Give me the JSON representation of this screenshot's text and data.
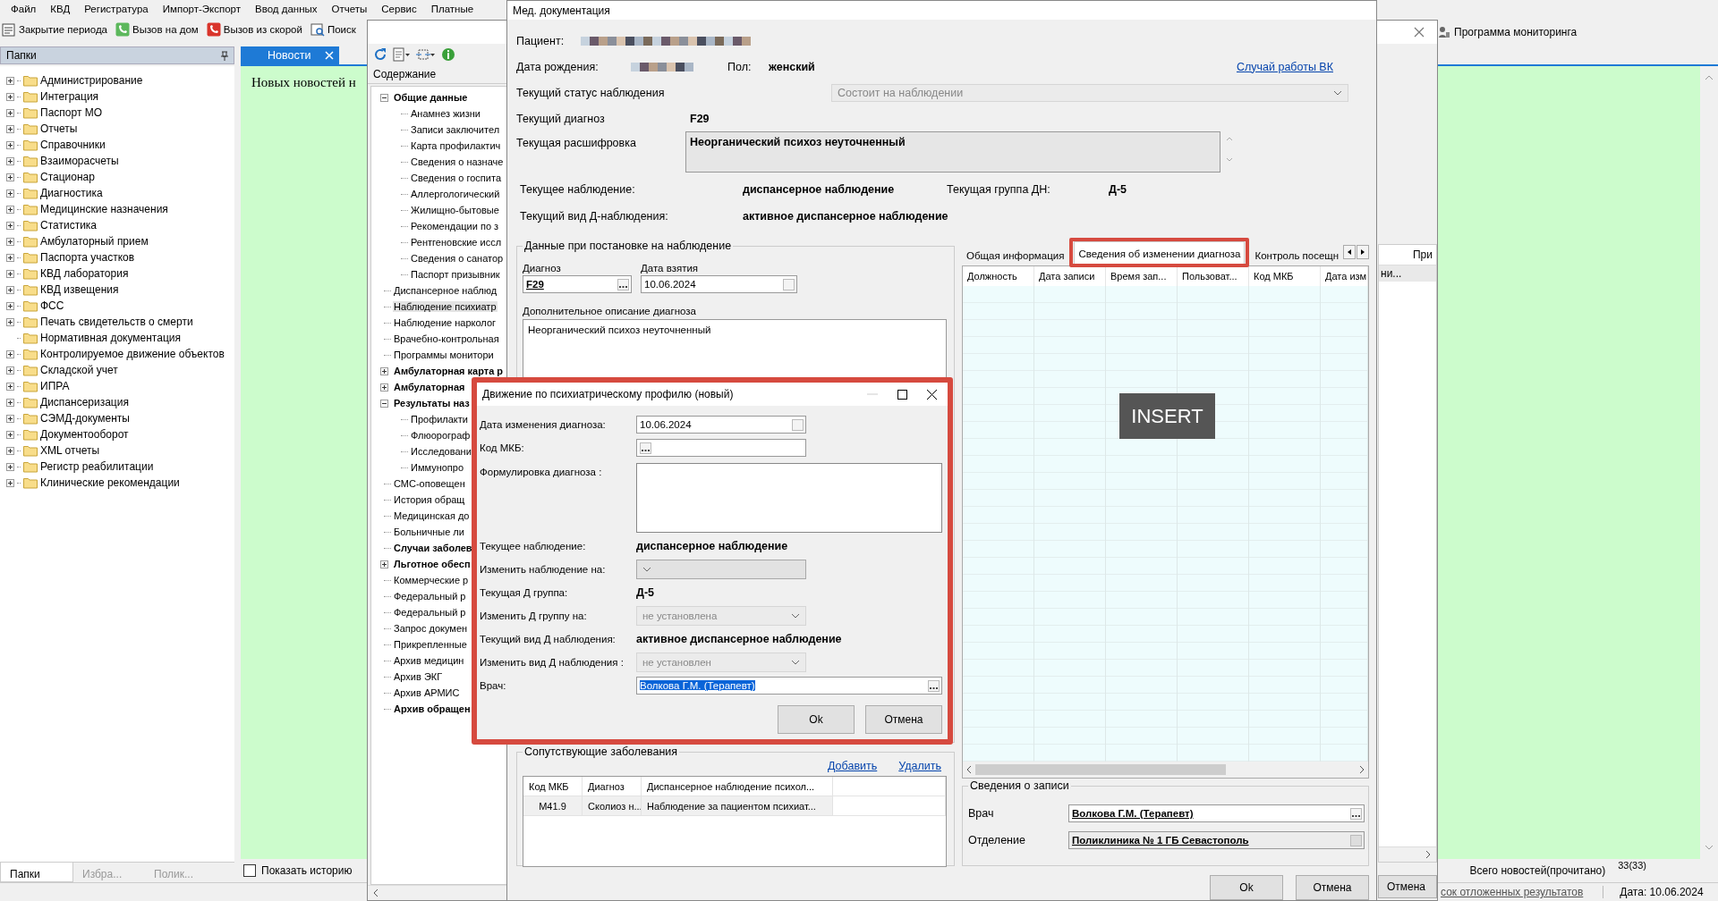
{
  "menu": [
    "Файл",
    "КВД",
    "Регистратура",
    "Импорт-Экспорт",
    "Ввод данных",
    "Отчеты",
    "Сервис",
    "Платные"
  ],
  "toolbar": [
    "Закрытие периода",
    "Вызов на дом",
    "Вызов из скорой",
    "Поиск"
  ],
  "toolbar_right": "Программа мониторинга",
  "folders": {
    "title": "Папки",
    "items": [
      {
        "label": "Администрирование",
        "expandable": true
      },
      {
        "label": "Интеграция",
        "expandable": true
      },
      {
        "label": "Паспорт МО",
        "expandable": true
      },
      {
        "label": "Отчеты",
        "expandable": true
      },
      {
        "label": "Справочники",
        "expandable": true
      },
      {
        "label": "Взаиморасчеты",
        "expandable": true
      },
      {
        "label": "Стационар",
        "expandable": true
      },
      {
        "label": "Диагностика",
        "expandable": true
      },
      {
        "label": "Медицинские назначения",
        "expandable": true
      },
      {
        "label": "Статистика",
        "expandable": true
      },
      {
        "label": "Амбулаторный прием",
        "expandable": true
      },
      {
        "label": "Паспорта участков",
        "expandable": true
      },
      {
        "label": "КВД лаборатория",
        "expandable": true
      },
      {
        "label": "КВД извещения",
        "expandable": true
      },
      {
        "label": "ФСС",
        "expandable": true
      },
      {
        "label": "Печать свидетельств о смерти",
        "expandable": true
      },
      {
        "label": "Нормативная документация",
        "expandable": false
      },
      {
        "label": "Контролируемое движение объектов",
        "expandable": true
      },
      {
        "label": "Складской учет",
        "expandable": true
      },
      {
        "label": "ИПРА",
        "expandable": true
      },
      {
        "label": "Диспансеризация",
        "expandable": true
      },
      {
        "label": "СЭМД-документы",
        "expandable": true
      },
      {
        "label": "Документооборот",
        "expandable": true
      },
      {
        "label": "XML отчеты",
        "expandable": true
      },
      {
        "label": "Регистр реабилитации",
        "expandable": true
      },
      {
        "label": "Клинические рекомендации",
        "expandable": true
      }
    ],
    "tabs": [
      {
        "label": "Папки",
        "selected": true
      },
      {
        "label": "Избра...",
        "selected": false
      },
      {
        "label": "Полик...",
        "selected": false
      }
    ]
  },
  "news": {
    "tab": "Новости",
    "message": "Новых новостей н",
    "show_history": {
      "label": "Показать историю",
      "checked": false
    },
    "total_label": "Всего новостей(прочитано)",
    "total": "33(33)"
  },
  "status_bar": {
    "link": "сок отложенных результатов",
    "date": "Дата: 10.06.2024"
  },
  "contents": {
    "header": "Содержание",
    "tree": [
      {
        "label": "Общие данные",
        "bold": true,
        "selected": false,
        "expanded": true,
        "children": [
          {
            "label": "Анамнез жизни",
            "bold": false,
            "selected": false
          },
          {
            "label": "Записи заключител",
            "bold": false,
            "selected": false
          },
          {
            "label": "Карта профилактич",
            "bold": false,
            "selected": false
          },
          {
            "label": "Сведения о назначе",
            "bold": false,
            "selected": false
          },
          {
            "label": "Сведения о госпита",
            "bold": false,
            "selected": false
          },
          {
            "label": "Аллергологический",
            "bold": false,
            "selected": false
          },
          {
            "label": "Жилищно-бытовые",
            "bold": false,
            "selected": false
          },
          {
            "label": "Рекомендации по з",
            "bold": false,
            "selected": false
          },
          {
            "label": "Рентгеновские иссл",
            "bold": false,
            "selected": false
          },
          {
            "label": "Сведения о санатор",
            "bold": false,
            "selected": false
          },
          {
            "label": "Паспорт призывник",
            "bold": false,
            "selected": false
          }
        ]
      },
      {
        "label": "Диспансерное наблюд",
        "bold": false,
        "selected": false
      },
      {
        "label": "Наблюдение психиатр",
        "bold": false,
        "selected": true
      },
      {
        "label": "Наблюдение нарколог",
        "bold": false,
        "selected": false
      },
      {
        "label": "Врачебно-контрольная",
        "bold": false,
        "selected": false
      },
      {
        "label": "Программы монитори",
        "bold": false,
        "selected": false
      },
      {
        "label": "Амбулаторная карта р",
        "bold": true,
        "selected": false,
        "expanded": false
      },
      {
        "label": "Амбулаторная",
        "bold": true,
        "selected": false,
        "expanded": false
      },
      {
        "label": "Результаты наз",
        "bold": true,
        "selected": false,
        "expanded": true,
        "children": [
          {
            "label": "Профилакти",
            "bold": false,
            "selected": false
          },
          {
            "label": "Флюорограф",
            "bold": false,
            "selected": false
          },
          {
            "label": "Исследовани",
            "bold": false,
            "selected": false
          },
          {
            "label": "Иммунопро",
            "bold": false,
            "selected": false
          }
        ]
      },
      {
        "label": "СМС-оповещен",
        "bold": false,
        "selected": false
      },
      {
        "label": "История обращ",
        "bold": false,
        "selected": false
      },
      {
        "label": "Медицинская до",
        "bold": false,
        "selected": false
      },
      {
        "label": "Больничные ли",
        "bold": false,
        "selected": false
      },
      {
        "label": "Случаи заболев",
        "bold": true,
        "selected": false
      },
      {
        "label": "Льготное обесп",
        "bold": true,
        "selected": false,
        "expanded": false
      },
      {
        "label": "Коммерческие р",
        "bold": false,
        "selected": false
      },
      {
        "label": "Федеральный р",
        "bold": false,
        "selected": false
      },
      {
        "label": "Федеральный р",
        "bold": false,
        "selected": false
      },
      {
        "label": "Запрос докумен",
        "bold": false,
        "selected": false
      },
      {
        "label": "Прикрепленные",
        "bold": false,
        "selected": false
      },
      {
        "label": "Архив медицин",
        "bold": false,
        "selected": false
      },
      {
        "label": "Архив ЭКГ",
        "bold": false,
        "selected": false
      },
      {
        "label": "Архив АРМИС",
        "bold": false,
        "selected": false
      },
      {
        "label": "Архив обращен",
        "bold": true,
        "selected": false
      }
    ],
    "column": "При",
    "cell": "ни...",
    "cancel": "Отмена"
  },
  "med_doc": {
    "title": "Мед. документация",
    "patient_label": "Пациент:",
    "birth_label": "Дата рождения:",
    "sex_label": "Пол:",
    "sex": "женский",
    "vk_link": "Случай работы ВК",
    "status_label": "Текущий статус наблюдения",
    "status": {
      "value": "Состоит на наблюдении",
      "disabled": true
    },
    "diagnosis_label": "Текущий диагноз",
    "diagnosis": "F29",
    "decoding_label": "Текущая расшифровка",
    "decoding": "Неорганический психоз неуточненный",
    "observation_label": "Текущее наблюдение:",
    "observation": "диспансерное наблюдение",
    "group_label": "Текущая группа ДН:",
    "group": "Д-5",
    "type_label": "Текущий вид Д-наблюдения:",
    "type": "активное диспансерное наблюдение",
    "registration": {
      "title": "Данные при постановке на наблюдение",
      "diagnosis_label": "Диагноз",
      "diagnosis": "F29",
      "date_label": "Дата взятия",
      "date": "10.06.2024",
      "description_label": "Дополнительное описание диагноза",
      "description": "Неорганический психоз неуточненный"
    },
    "tabs": [
      {
        "label": "Общая информация",
        "selected": false
      },
      {
        "label": "Сведения об изменении диагноза",
        "selected": true
      },
      {
        "label": "Контроль посещн",
        "selected": false
      }
    ],
    "history_table": {
      "columns": [
        "Должность",
        "Дата записи",
        "Время зап...",
        "Пользоват...",
        "Код МКБ",
        "Дата изм"
      ]
    },
    "record": {
      "title": "Сведения о записи",
      "doctor_label": "Врач",
      "doctor": "Волкова Г.М. (Терапевт)",
      "department_label": "Отделение",
      "department": "Поликлиника № 1 ГБ Севастополь"
    },
    "comorbid": {
      "title": "Сопутствующие заболевания",
      "add": "Добавить",
      "delete": "Удалить",
      "columns": [
        "Код МКБ",
        "Диагноз",
        "Диспансерное наблюдение психол..."
      ],
      "rows": [
        [
          "M41.9",
          "Сколиоз н...",
          "Наблюдение за пациентом психиат..."
        ]
      ]
    },
    "buttons": [
      "Ok",
      "Отмена"
    ]
  },
  "dialog": {
    "title": "Движение по психиатрическому профилю (новый)",
    "fields": [
      {
        "kind": "date",
        "label": "Дата изменения диагноза:",
        "value": "10.06.2024"
      },
      {
        "kind": "picker",
        "label": "Код МКБ:"
      },
      {
        "kind": "memo",
        "label": "Формулировка диагноза :"
      },
      {
        "kind": "info",
        "label": "Текущее наблюдение:",
        "value": "диспансерное наблюдение"
      },
      {
        "kind": "combo",
        "label": "Изменить наблюдение на:",
        "disabled": false
      },
      {
        "kind": "info",
        "label": "Текущая Д группа:",
        "value": "Д-5"
      },
      {
        "kind": "combo",
        "label": "Изменить Д группу на:",
        "value": "не установлена",
        "disabled": true
      },
      {
        "kind": "info",
        "label": "Текущий вид Д наблюдения:",
        "value": "активное диспансерное наблюдение"
      },
      {
        "kind": "combo",
        "label": "Изменить вид Д наблюдения :",
        "value": "не установлен",
        "disabled": true
      },
      {
        "kind": "doctor",
        "label": "Врач:",
        "value": "Волкова Г.М. (Терапевт)",
        "selected": true
      }
    ],
    "buttons": [
      "Ok",
      "Отмена"
    ]
  },
  "overlay": "INSERT"
}
